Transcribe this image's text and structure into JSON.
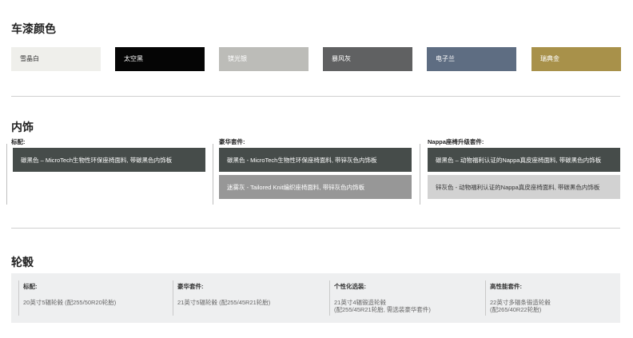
{
  "paint": {
    "title": "车漆颜色",
    "swatches": [
      {
        "label": "雪晶白",
        "bg": "#efefeb",
        "fg": "#333333"
      },
      {
        "label": "太空黑",
        "bg": "#050505",
        "fg": "#ffffff"
      },
      {
        "label": "镁光银",
        "bg": "#bcbcb8",
        "fg": "#ffffff"
      },
      {
        "label": "暴风灰",
        "bg": "#606162",
        "fg": "#ffffff"
      },
      {
        "label": "电子兰",
        "bg": "#5e6d82",
        "fg": "#ffffff"
      },
      {
        "label": "瑞典金",
        "bg": "#a8914a",
        "fg": "#ffffff"
      }
    ]
  },
  "interior": {
    "title": "内饰",
    "groups": [
      {
        "heading": "标配:",
        "options": [
          {
            "label": "碳黑色 – MicroTech生物性环保座椅面料, 带碳黑色内饰板",
            "bg": "#464c4a",
            "fg": "#ffffff"
          }
        ]
      },
      {
        "heading": "豪华套件:",
        "options": [
          {
            "label": "碳黑色 - MicroTech生物性环保座椅面料, 带锌灰色内饰板",
            "bg": "#464c4a",
            "fg": "#ffffff"
          },
          {
            "label": "迷雾灰 - Tailored Knit编织座椅面料, 带锌灰色内饰板",
            "bg": "#979797",
            "fg": "#ffffff"
          }
        ]
      },
      {
        "heading": "Nappa座椅升级套件:",
        "options": [
          {
            "label": "碳黑色 – 动物福利认证的Nappa真皮座椅面料, 带碳黑色内饰板",
            "bg": "#464c4a",
            "fg": "#ffffff"
          },
          {
            "label": "锌灰色 - 动物福利认证的Nappa真皮座椅面料, 带碳黑色内饰板",
            "bg": "#d2d2d2",
            "fg": "#333333"
          }
        ]
      }
    ]
  },
  "wheels": {
    "title": "轮毂",
    "columns": [
      {
        "heading": "标配:",
        "lines": [
          "20英寸5辐轮毂 (配255/50R20轮胎)"
        ]
      },
      {
        "heading": "豪华套件:",
        "lines": [
          "21英寸5辐轮毂 (配255/45R21轮胎)"
        ]
      },
      {
        "heading": "个性化选装:",
        "lines": [
          "21英寸4辐锻造轮毂",
          "(配255/45R21轮胎, 需选装豪华套件)"
        ]
      },
      {
        "heading": "高性能套件:",
        "lines": [
          "22英寸多辐条锻造轮毂",
          "(配265/40R22轮胎)"
        ]
      }
    ]
  }
}
